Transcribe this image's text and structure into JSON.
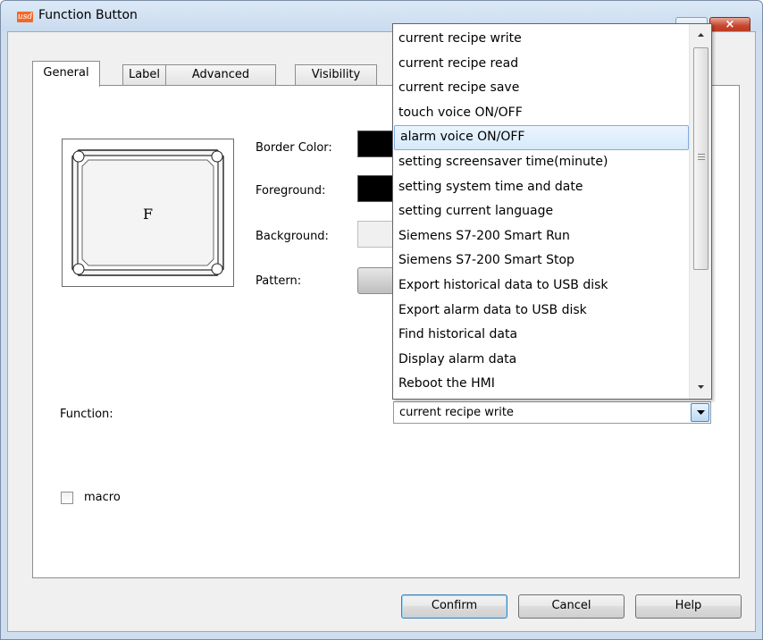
{
  "window": {
    "title": "Function Button",
    "close_glyph": "×",
    "icon_text": "usd"
  },
  "tabs": [
    {
      "label": "General",
      "active": true
    },
    {
      "label": "Label",
      "active": false
    },
    {
      "label": "Advanced",
      "active": false
    },
    {
      "label": "Visibility",
      "active": false
    }
  ],
  "preview": {
    "text": "F"
  },
  "colors": {
    "border_color_label": "Border Color:",
    "foreground_label": "Foreground:",
    "background_label": "Background:",
    "pattern_label": "Pattern:",
    "border_color_value": "#000000",
    "foreground_value": "#000000",
    "background_value": "#f0f0f0"
  },
  "function": {
    "label": "Function:",
    "selected": "current recipe write"
  },
  "dropdown": {
    "items": [
      "current recipe write",
      "current recipe read",
      "current recipe save",
      "touch voice ON/OFF",
      "alarm voice ON/OFF",
      "setting screensaver time(minute)",
      "setting system time and date",
      "setting current language",
      "Siemens S7-200 Smart Run",
      "Siemens S7-200 Smart Stop",
      "Export historical data to USB disk",
      "Export alarm data to USB disk",
      "Find historical data",
      "Display alarm data",
      "Reboot the HMI"
    ],
    "highlighted_index": 4
  },
  "macro": {
    "label": "macro",
    "checked": false
  },
  "buttons": {
    "confirm": "Confirm",
    "cancel": "Cancel",
    "help": "Help"
  },
  "accent": {
    "highlight_border": "#84acdd",
    "title_bar": "#c9dbef",
    "close_button": "#c6472d"
  }
}
